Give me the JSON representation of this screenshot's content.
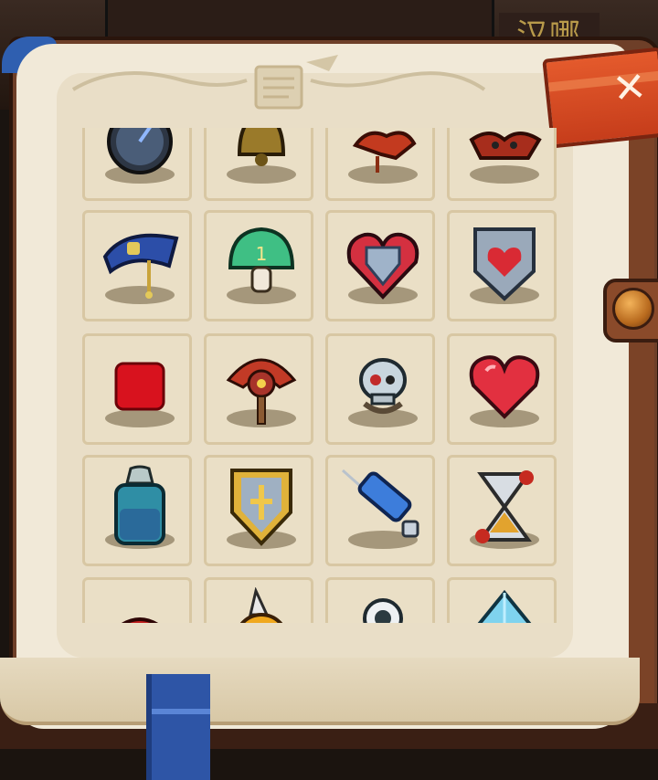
{
  "header": {
    "background_label": "汉哪",
    "close_button_label": "✕",
    "decoration": "scroll-quill-emblem"
  },
  "grid": {
    "visible_rows": 5,
    "columns": 4,
    "items": [
      {
        "id": "clock",
        "icon": "pocket-watch-icon"
      },
      {
        "id": "bell",
        "icon": "bell-icon"
      },
      {
        "id": "red-item",
        "icon": "red-fang-icon"
      },
      {
        "id": "crab",
        "icon": "crab-claw-icon"
      },
      {
        "id": "blue-cap",
        "icon": "blue-cap-icon"
      },
      {
        "id": "mushroom",
        "icon": "green-mushroom-icon"
      },
      {
        "id": "heart-shield",
        "icon": "heart-shield-icon"
      },
      {
        "id": "heart-crest",
        "icon": "heart-crest-icon"
      },
      {
        "id": "red-cube",
        "icon": "red-cube-icon"
      },
      {
        "id": "totem",
        "icon": "tribal-totem-icon"
      },
      {
        "id": "skull",
        "icon": "skull-icon"
      },
      {
        "id": "heart",
        "icon": "red-heart-icon"
      },
      {
        "id": "potion",
        "icon": "blue-potion-icon"
      },
      {
        "id": "gold-shield",
        "icon": "gold-shield-icon"
      },
      {
        "id": "syringe",
        "icon": "syringe-icon"
      },
      {
        "id": "hourglass",
        "icon": "hourglass-icon"
      },
      {
        "id": "red-dome",
        "icon": "red-dome-icon"
      },
      {
        "id": "spike-helmet",
        "icon": "spike-helmet-icon"
      },
      {
        "id": "robot",
        "icon": "robot-icon"
      },
      {
        "id": "crystal",
        "icon": "crystal-icon"
      }
    ]
  }
}
